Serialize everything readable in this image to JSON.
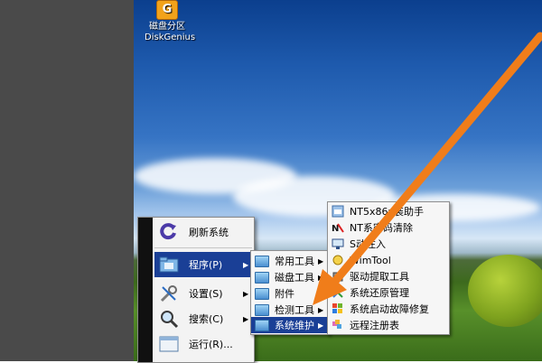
{
  "desktop_icon": {
    "label_line1": "磁盘分区",
    "label_line2": "DiskGenius"
  },
  "start_menu": {
    "items": [
      {
        "label": "刷新系统",
        "icon": "refresh-icon",
        "arrow": ""
      },
      {
        "label": "程序(P)",
        "icon": "programs-folder-icon",
        "arrow": "▶"
      },
      {
        "label": "设置(S)",
        "icon": "settings-tools-icon",
        "arrow": "▶"
      },
      {
        "label": "搜索(C)",
        "icon": "search-magnifier-icon",
        "arrow": "▶"
      },
      {
        "label": "运行(R)...",
        "icon": "run-window-icon",
        "arrow": ""
      }
    ]
  },
  "programs_menu": {
    "items": [
      {
        "label": "常用工具",
        "arrow": "▶"
      },
      {
        "label": "磁盘工具",
        "arrow": "▶"
      },
      {
        "label": "附件",
        "arrow": "▶"
      },
      {
        "label": "检测工具",
        "arrow": "▶"
      },
      {
        "label": "系统维护",
        "arrow": "▶"
      }
    ]
  },
  "maintenance_menu": {
    "items": [
      {
        "label": "NT5x86x装助手",
        "icon": "installer-icon"
      },
      {
        "label": "NT系密码清除",
        "icon": "password-key-icon"
      },
      {
        "label": "S动注入",
        "icon": "driver-monitor-icon"
      },
      {
        "label": "WimTool",
        "icon": "wim-tool-icon"
      },
      {
        "label": "驱动提取工具",
        "icon": "driver-extract-icon"
      },
      {
        "label": "系统还原管理",
        "icon": "restore-icon"
      },
      {
        "label": "系统启动故障修复",
        "icon": "windows-repair-icon"
      },
      {
        "label": "远程注册表",
        "icon": "registry-icon"
      }
    ]
  },
  "colors": {
    "highlight": "#1a3f96",
    "arrow": "#f07d1a",
    "menu_bg": "#f3f3f3"
  }
}
